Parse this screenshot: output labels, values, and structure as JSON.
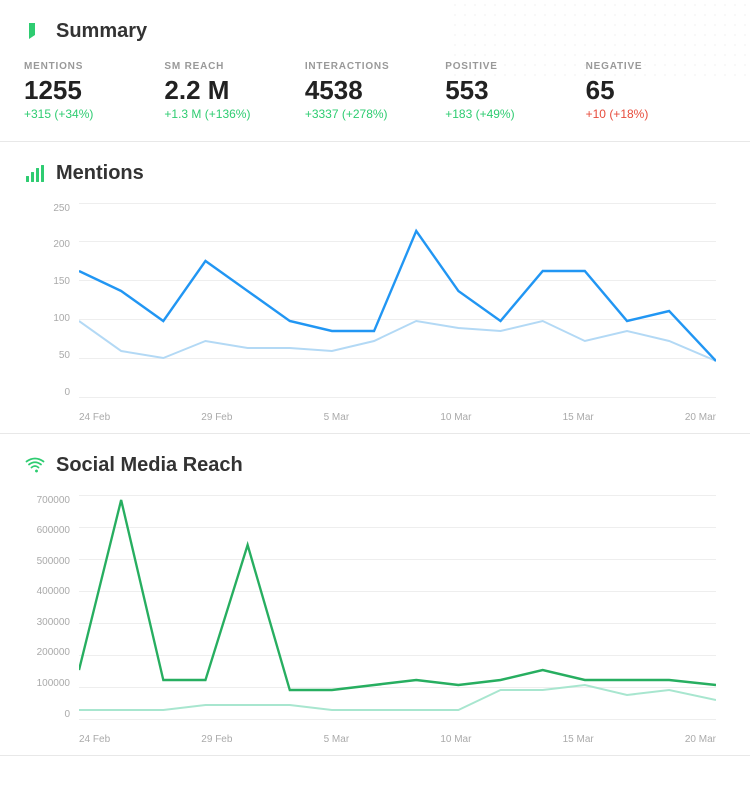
{
  "summary": {
    "title": "Summary",
    "icon_color": "#2ecc71",
    "stats": [
      {
        "label": "MENTIONS",
        "value": "1255",
        "change": "+315 (+34%)",
        "change_type": "positive"
      },
      {
        "label": "SM REACH",
        "value": "2.2 M",
        "change": "+1.3 M (+136%)",
        "change_type": "positive"
      },
      {
        "label": "INTERACTIONS",
        "value": "4538",
        "change": "+3337 (+278%)",
        "change_type": "positive"
      },
      {
        "label": "POSITIVE",
        "value": "553",
        "change": "+183 (+49%)",
        "change_type": "positive"
      },
      {
        "label": "NEGATIVE",
        "value": "65",
        "change": "+10 (+18%)",
        "change_type": "negative"
      }
    ]
  },
  "mentions_chart": {
    "title": "Mentions",
    "y_labels": [
      "250",
      "200",
      "150",
      "100",
      "50",
      "0"
    ],
    "x_labels": [
      "24 Feb",
      "29 Feb",
      "5 Mar",
      "10 Mar",
      "15 Mar",
      "20 Mar"
    ]
  },
  "reach_chart": {
    "title": "Social Media Reach",
    "y_labels": [
      "700000",
      "600000",
      "500000",
      "400000",
      "300000",
      "200000",
      "100000",
      "0"
    ],
    "x_labels": [
      "24 Feb",
      "29 Feb",
      "5 Mar",
      "10 Mar",
      "15 Mar",
      "20 Mar"
    ]
  }
}
